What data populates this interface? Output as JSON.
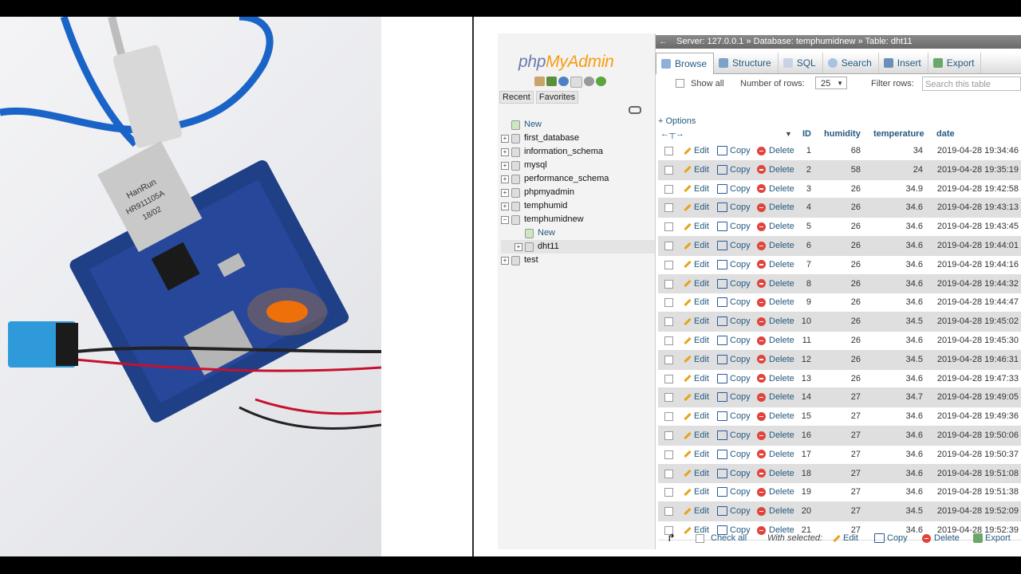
{
  "logo": {
    "php": "php",
    "my": "MyAdmin"
  },
  "nav_tabs": [
    "Recent",
    "Favorites"
  ],
  "tree": [
    {
      "label": "New",
      "kind": "new"
    },
    {
      "label": "first_database",
      "kind": "db"
    },
    {
      "label": "information_schema",
      "kind": "db"
    },
    {
      "label": "mysql",
      "kind": "db"
    },
    {
      "label": "performance_schema",
      "kind": "db"
    },
    {
      "label": "phpmyadmin",
      "kind": "db"
    },
    {
      "label": "temphumid",
      "kind": "db"
    },
    {
      "label": "temphumidnew",
      "kind": "db-open"
    },
    {
      "label": "New",
      "kind": "sub-new"
    },
    {
      "label": "dht11",
      "kind": "table-selected"
    },
    {
      "label": "test",
      "kind": "db"
    }
  ],
  "breadcrumb": {
    "server": "Server: 127.0.0.1 »",
    "database": "Database: temphumidnew »",
    "table": "Table: dht11"
  },
  "menu": [
    "Browse",
    "Structure",
    "SQL",
    "Search",
    "Insert",
    "Export"
  ],
  "toolbar": {
    "show_all": "Show all",
    "rows_label": "Number of rows:",
    "rows_value": "25",
    "filter_label": "Filter rows:",
    "filter_placeholder": "Search this table"
  },
  "options_label": "+ Options",
  "columns": [
    "ID",
    "humidity",
    "temperature",
    "date"
  ],
  "actions": {
    "edit": "Edit",
    "copy": "Copy",
    "delete": "Delete"
  },
  "rows": [
    {
      "id": "1",
      "humidity": "68",
      "temperature": "34",
      "date": "2019-04-28 19:34:46"
    },
    {
      "id": "2",
      "humidity": "58",
      "temperature": "24",
      "date": "2019-04-28 19:35:19"
    },
    {
      "id": "3",
      "humidity": "26",
      "temperature": "34.9",
      "date": "2019-04-28 19:42:58"
    },
    {
      "id": "4",
      "humidity": "26",
      "temperature": "34.6",
      "date": "2019-04-28 19:43:13"
    },
    {
      "id": "5",
      "humidity": "26",
      "temperature": "34.6",
      "date": "2019-04-28 19:43:45"
    },
    {
      "id": "6",
      "humidity": "26",
      "temperature": "34.6",
      "date": "2019-04-28 19:44:01"
    },
    {
      "id": "7",
      "humidity": "26",
      "temperature": "34.6",
      "date": "2019-04-28 19:44:16"
    },
    {
      "id": "8",
      "humidity": "26",
      "temperature": "34.6",
      "date": "2019-04-28 19:44:32"
    },
    {
      "id": "9",
      "humidity": "26",
      "temperature": "34.6",
      "date": "2019-04-28 19:44:47"
    },
    {
      "id": "10",
      "humidity": "26",
      "temperature": "34.5",
      "date": "2019-04-28 19:45:02"
    },
    {
      "id": "11",
      "humidity": "26",
      "temperature": "34.6",
      "date": "2019-04-28 19:45:30"
    },
    {
      "id": "12",
      "humidity": "26",
      "temperature": "34.5",
      "date": "2019-04-28 19:46:31"
    },
    {
      "id": "13",
      "humidity": "26",
      "temperature": "34.6",
      "date": "2019-04-28 19:47:33"
    },
    {
      "id": "14",
      "humidity": "27",
      "temperature": "34.7",
      "date": "2019-04-28 19:49:05"
    },
    {
      "id": "15",
      "humidity": "27",
      "temperature": "34.6",
      "date": "2019-04-28 19:49:36"
    },
    {
      "id": "16",
      "humidity": "27",
      "temperature": "34.6",
      "date": "2019-04-28 19:50:06"
    },
    {
      "id": "17",
      "humidity": "27",
      "temperature": "34.6",
      "date": "2019-04-28 19:50:37"
    },
    {
      "id": "18",
      "humidity": "27",
      "temperature": "34.6",
      "date": "2019-04-28 19:51:08"
    },
    {
      "id": "19",
      "humidity": "27",
      "temperature": "34.6",
      "date": "2019-04-28 19:51:38"
    },
    {
      "id": "20",
      "humidity": "27",
      "temperature": "34.5",
      "date": "2019-04-28 19:52:09"
    },
    {
      "id": "21",
      "humidity": "27",
      "temperature": "34.6",
      "date": "2019-04-28 19:52:39"
    }
  ],
  "footer": {
    "check_all": "Check all",
    "with_selected": "With selected:",
    "edit": "Edit",
    "copy": "Copy",
    "delete": "Delete",
    "export": "Export"
  },
  "photo_labels": {
    "connector_line1": "HanRun",
    "connector_line2": "HR911105A",
    "connector_line3": "18/02"
  },
  "colors": {
    "link": "#235a81",
    "row_even": "#dfdfdf",
    "breadcrumb_bg": "#7a7a7a",
    "delete_icon": "#e0443c",
    "led": "#ff6a00"
  }
}
